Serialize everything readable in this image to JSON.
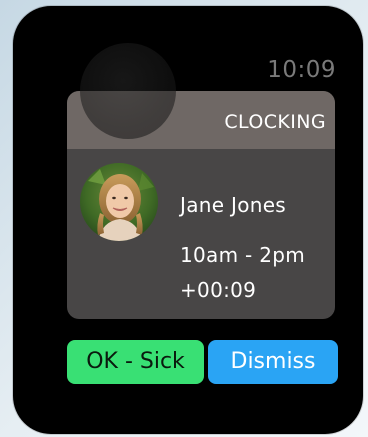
{
  "status_bar": {
    "time": "10:09"
  },
  "card": {
    "header_label": "CLOCKING",
    "employee_name": "Jane Jones",
    "shift": "10am - 2pm",
    "elapsed": "+00:09"
  },
  "actions": {
    "ok_label": "OK - Sick",
    "dismiss_label": "Dismiss"
  },
  "colors": {
    "ok_button": "#39e074",
    "dismiss_button": "#2aa4f4",
    "card_background": "#484646",
    "card_header": "#6f6865"
  },
  "icons": [
    "employee-avatar"
  ]
}
